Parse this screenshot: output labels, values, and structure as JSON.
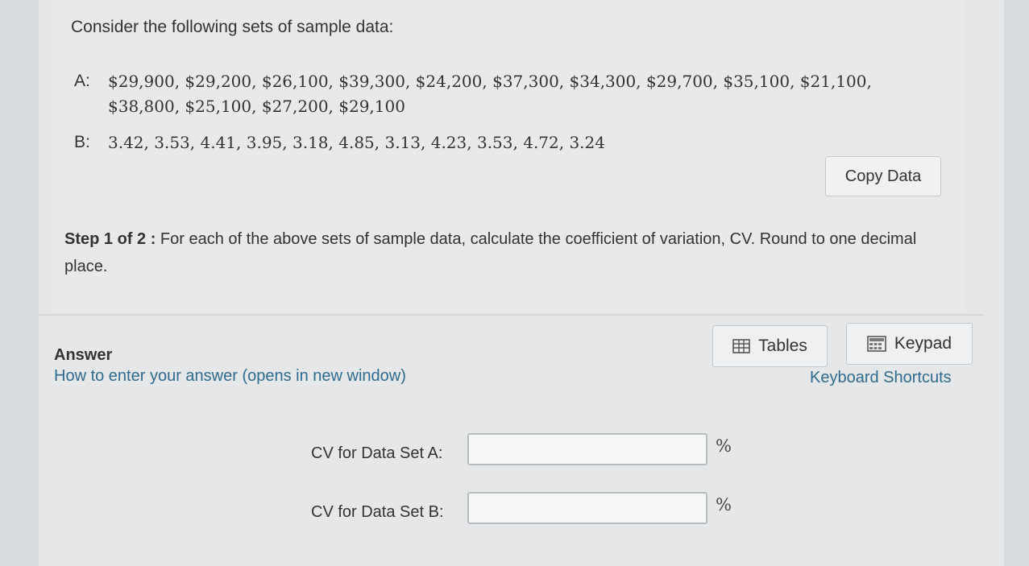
{
  "intro": "Consider the following sets of sample data:",
  "datasets": [
    {
      "label": "A:",
      "line1": "$29,900, $29,200, $26,100, $39,300, $24,200, $37,300, $34,300, $29,700, $35,100, $21,100,",
      "line2": "$38,800, $25,100, $27,200, $29,100"
    },
    {
      "label": "B:",
      "line1": "3.42, 3.53, 4.41, 3.95, 3.18, 4.85, 3.13, 4.23, 3.53, 4.72, 3.24"
    }
  ],
  "copy_button": "Copy Data",
  "step": {
    "prefix": "Step 1 of 2 :",
    "text": "For each of the above sets of sample data, calculate the coefficient of variation, CV. Round to one decimal place."
  },
  "answer": {
    "title": "Answer",
    "howto_link": "How to enter your answer (opens in new window)",
    "tables_button": "Tables",
    "keypad_button": "Keypad",
    "keyboard_shortcuts": "Keyboard Shortcuts",
    "fields": [
      {
        "label": "CV for Data Set A:",
        "value": "",
        "unit": "%"
      },
      {
        "label": "CV for Data Set B:",
        "value": "",
        "unit": "%"
      }
    ]
  },
  "icons": {
    "tables": "table-grid-icon",
    "keypad": "keypad-icon"
  }
}
